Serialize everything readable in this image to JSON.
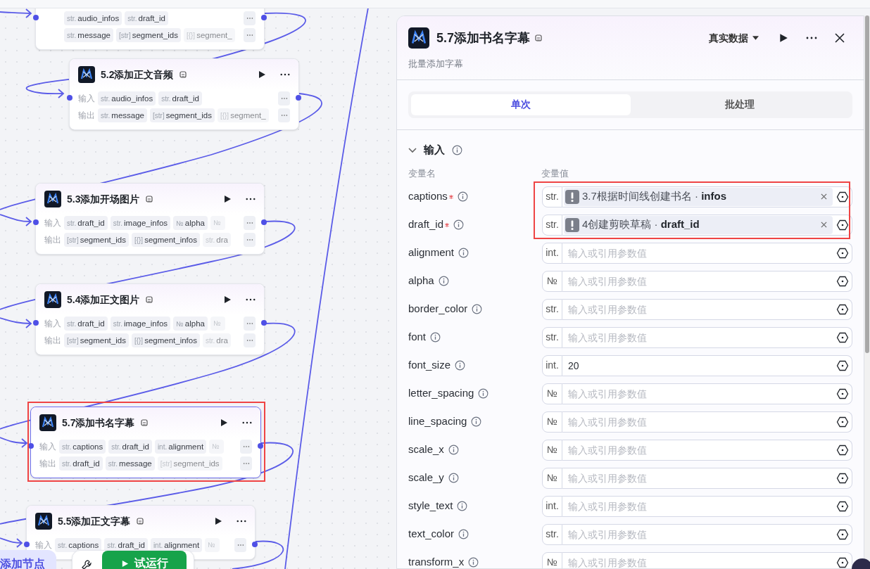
{
  "canvas": {
    "nodes": [
      {
        "inputs": [
          {
            "type": "str.",
            "name": "audio_infos",
            "faded": false
          },
          {
            "type": "str.",
            "name": "draft_id",
            "faded": false
          }
        ],
        "outputs": [
          {
            "type": "str.",
            "name": "message",
            "faded": false
          },
          {
            "type": "[str]",
            "name": "segment_ids",
            "faded": false
          },
          {
            "type": "[{}]",
            "name": "segment_",
            "faded": true
          }
        ],
        "selected": false
      },
      {
        "title": "5.2添加正文音频",
        "input_label": "输入",
        "output_label": "输出",
        "inputs": [
          {
            "type": "str.",
            "name": "audio_infos",
            "faded": false
          },
          {
            "type": "str.",
            "name": "draft_id",
            "faded": false
          }
        ],
        "outputs": [
          {
            "type": "str.",
            "name": "message",
            "faded": false
          },
          {
            "type": "[str]",
            "name": "segment_ids",
            "faded": false
          },
          {
            "type": "[{}]",
            "name": "segment_",
            "faded": true
          }
        ],
        "selected": false
      },
      {
        "title": "5.3添加开场图片",
        "input_label": "输入",
        "output_label": "输出",
        "inputs": [
          {
            "type": "str.",
            "name": "draft_id",
            "faded": false
          },
          {
            "type": "str.",
            "name": "image_infos",
            "faded": false
          },
          {
            "type": "№",
            "name": "alpha",
            "faded": false
          },
          {
            "type": "№",
            "faded": true
          }
        ],
        "outputs": [
          {
            "type": "[str]",
            "name": "segment_ids",
            "faded": false
          },
          {
            "type": "[{}]",
            "name": "segment_infos",
            "faded": false
          },
          {
            "type": "str.",
            "name": "dra",
            "faded": true
          }
        ],
        "selected": false
      },
      {
        "title": "5.4添加正文图片",
        "input_label": "输入",
        "output_label": "输出",
        "inputs": [
          {
            "type": "str.",
            "name": "draft_id",
            "faded": false
          },
          {
            "type": "str.",
            "name": "image_infos",
            "faded": false
          },
          {
            "type": "№",
            "name": "alpha",
            "faded": false
          },
          {
            "type": "№",
            "faded": true
          }
        ],
        "outputs": [
          {
            "type": "[str]",
            "name": "segment_ids",
            "faded": false
          },
          {
            "type": "[{}]",
            "name": "segment_infos",
            "faded": false
          },
          {
            "type": "str.",
            "name": "dra",
            "faded": true
          }
        ],
        "selected": false
      },
      {
        "title": "5.7添加书名字幕",
        "input_label": "输入",
        "output_label": "输出",
        "inputs": [
          {
            "type": "str.",
            "name": "captions",
            "faded": false
          },
          {
            "type": "str.",
            "name": "draft_id",
            "faded": false
          },
          {
            "type": "int.",
            "name": "alignment",
            "faded": false
          },
          {
            "type": "№",
            "faded": true
          }
        ],
        "outputs": [
          {
            "type": "str.",
            "name": "draft_id",
            "faded": false
          },
          {
            "type": "str.",
            "name": "message",
            "faded": false
          },
          {
            "type": "[str]",
            "name": "segment_ids",
            "faded": true
          }
        ],
        "selected": true
      },
      {
        "title": "5.5添加正文字幕",
        "input_label": "输入",
        "inputs": [
          {
            "type": "str.",
            "name": "captions",
            "faded": false
          },
          {
            "type": "str.",
            "name": "draft_id",
            "faded": false
          },
          {
            "type": "int.",
            "name": "alignment",
            "faded": false
          },
          {
            "type": "№",
            "faded": true
          }
        ],
        "selected": false
      }
    ],
    "toolbar": {
      "add_node": "添加节点",
      "test_run": "试运行"
    }
  },
  "panel": {
    "title": "5.7添加书名字幕",
    "data_source": "真实数据",
    "description": "批量添加字幕",
    "tabs": [
      {
        "label": "单次",
        "selected": true
      },
      {
        "label": "批处理",
        "selected": false
      }
    ],
    "section": {
      "title": "输入",
      "expanded": true
    },
    "columns": [
      "变量名",
      "变量值"
    ],
    "fields": [
      {
        "name": "captions",
        "required": true,
        "type": "str.",
        "ref": "3.7根据时间线创建书名 · **infos**",
        "highlighted": true
      },
      {
        "name": "draft_id",
        "required": true,
        "type": "str.",
        "ref": "4创建剪映草稿 · **draft_id**",
        "highlighted": true
      },
      {
        "name": "alignment",
        "required": false,
        "type": "int.",
        "placeholder": "输入或引用参数值",
        "highlighted": false
      },
      {
        "name": "alpha",
        "required": false,
        "type": "№",
        "placeholder": "输入或引用参数值",
        "highlighted": false
      },
      {
        "name": "border_color",
        "required": false,
        "type": "str.",
        "placeholder": "输入或引用参数值",
        "highlighted": false
      },
      {
        "name": "font",
        "required": false,
        "type": "str.",
        "placeholder": "输入或引用参数值",
        "highlighted": false
      },
      {
        "name": "font_size",
        "required": false,
        "type": "int.",
        "value": "20",
        "highlighted": false
      },
      {
        "name": "letter_spacing",
        "required": false,
        "type": "№",
        "placeholder": "输入或引用参数值",
        "highlighted": false
      },
      {
        "name": "line_spacing",
        "required": false,
        "type": "№",
        "placeholder": "输入或引用参数值",
        "highlighted": false
      },
      {
        "name": "scale_x",
        "required": false,
        "type": "№",
        "placeholder": "输入或引用参数值",
        "highlighted": false
      },
      {
        "name": "scale_y",
        "required": false,
        "type": "№",
        "placeholder": "输入或引用参数值",
        "highlighted": false
      },
      {
        "name": "style_text",
        "required": false,
        "type": "int.",
        "placeholder": "输入或引用参数值",
        "highlighted": false
      },
      {
        "name": "text_color",
        "required": false,
        "type": "str.",
        "placeholder": "输入或引用参数值",
        "highlighted": false
      },
      {
        "name": "transform_x",
        "required": false,
        "type": "№",
        "placeholder": "输入或引用参数值",
        "highlighted": false
      }
    ]
  }
}
